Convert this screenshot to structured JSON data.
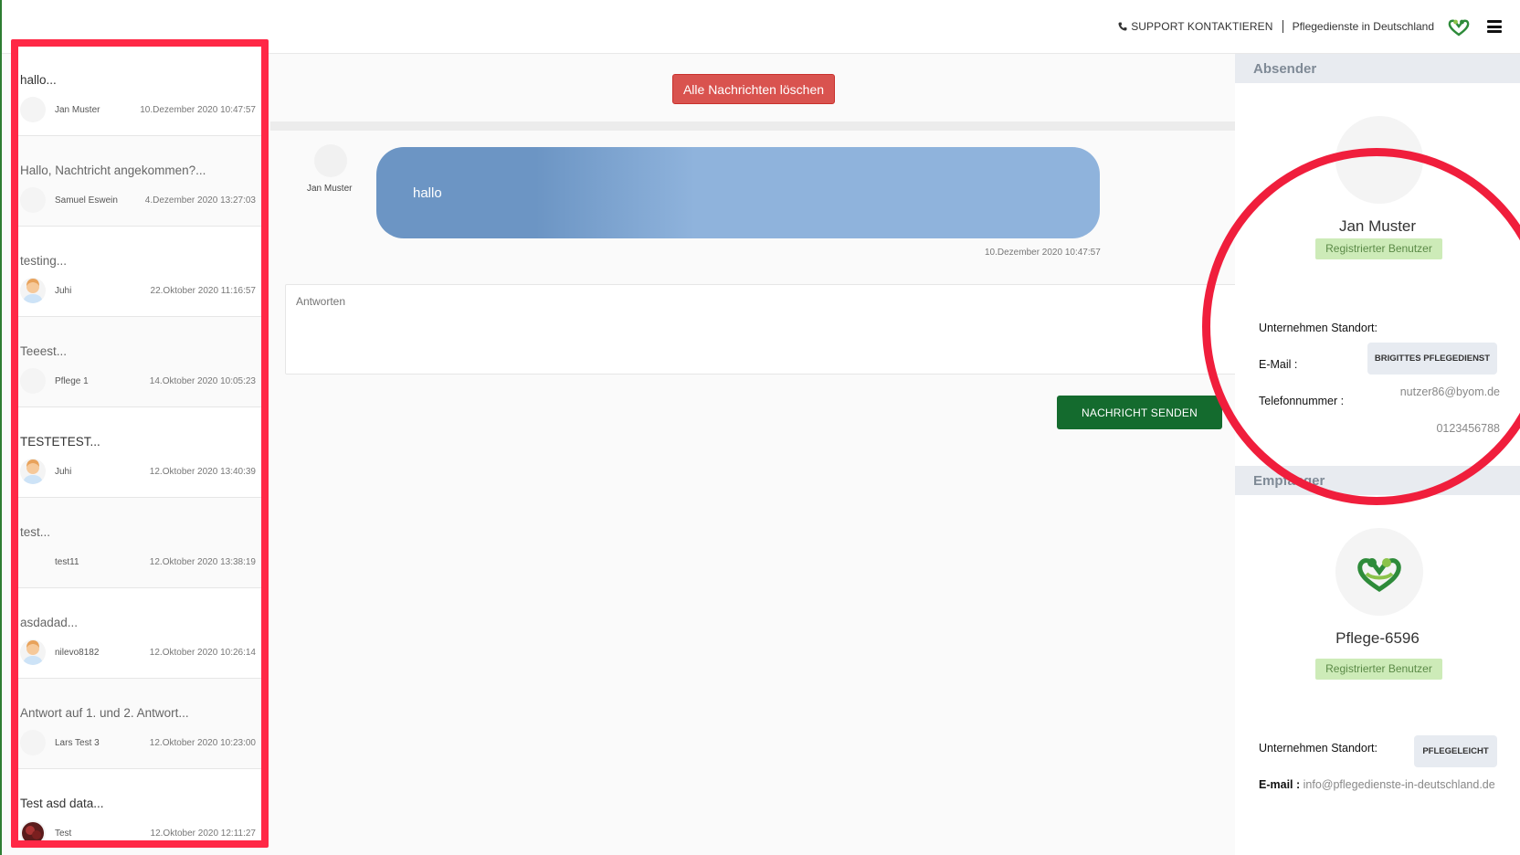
{
  "header": {
    "support_label": "SUPPORT KONTAKTIEREN",
    "brand_label": "Pflegedienste in Deutschland",
    "logo_icon": "heart-hands-logo-icon",
    "menu_icon": "hamburger-menu-icon"
  },
  "messages": [
    {
      "subject": "hallo...",
      "sender": "Jan Muster",
      "date": "10.Dezember 2020 10:47:57",
      "avatar": "blank"
    },
    {
      "subject": "Hallo, Nachtricht angekommen?...",
      "sender": "Samuel Eswein",
      "date": "4.Dezember 2020 13:27:03",
      "avatar": "blank"
    },
    {
      "subject": "testing...",
      "sender": "Juhi",
      "date": "22.Oktober 2020 11:16:57",
      "avatar": "person"
    },
    {
      "subject": "Teeest...",
      "sender": "Pflege 1",
      "date": "14.Oktober 2020 10:05:23",
      "avatar": "blank"
    },
    {
      "subject": "TESTETEST...",
      "sender": "Juhi",
      "date": "12.Oktober 2020 13:40:39",
      "avatar": "person"
    },
    {
      "subject": "test...",
      "sender": "test11",
      "date": "12.Oktober 2020 13:38:19",
      "avatar": "none"
    },
    {
      "subject": "asdadad...",
      "sender": "nilevo8182",
      "date": "12.Oktober 2020 10:26:14",
      "avatar": "person"
    },
    {
      "subject": "Antwort auf 1. und 2. Antwort...",
      "sender": "Lars Test 3",
      "date": "12.Oktober 2020 10:23:00",
      "avatar": "blank"
    },
    {
      "subject": "Test asd data...",
      "sender": "Test",
      "date": "12.Oktober 2020 12:11:27",
      "avatar": "photo"
    }
  ],
  "thread": {
    "delete_all_label": "Alle Nachrichten löschen",
    "sender_name": "Jan Muster",
    "message_text": "hallo",
    "message_date": "10.Dezember 2020 10:47:57",
    "reply_placeholder": "Antworten",
    "send_label": "NACHRICHT SENDEN"
  },
  "sender_panel": {
    "heading": "Absender",
    "name": "Jan Muster",
    "badge": "Registrierter Benutzer",
    "company_label": "Unternehmen Standort:",
    "company_value": "BRIGITTES PFLEGEDIENST",
    "email_label": "E-Mail :",
    "email_value": "nutzer86@byom.de",
    "phone_label": "Telefonnummer :",
    "phone_value": "0123456788"
  },
  "recipient_panel": {
    "heading": "Empfänger",
    "name": "Pflege-6596",
    "badge": "Registrierter Benutzer",
    "company_label": "Unternehmen Standort:",
    "company_value": "PFLEGELEICHT",
    "email_label": "E-mail :",
    "email_value": "info@pflegedienste-in-deutschland.de"
  },
  "colors": {
    "annotation_red": "#ff2846",
    "delete_red": "#d9534f",
    "send_green": "#146b2e",
    "bubble_blue": "#8fb3dc",
    "badge_green": "#cdebb8"
  }
}
